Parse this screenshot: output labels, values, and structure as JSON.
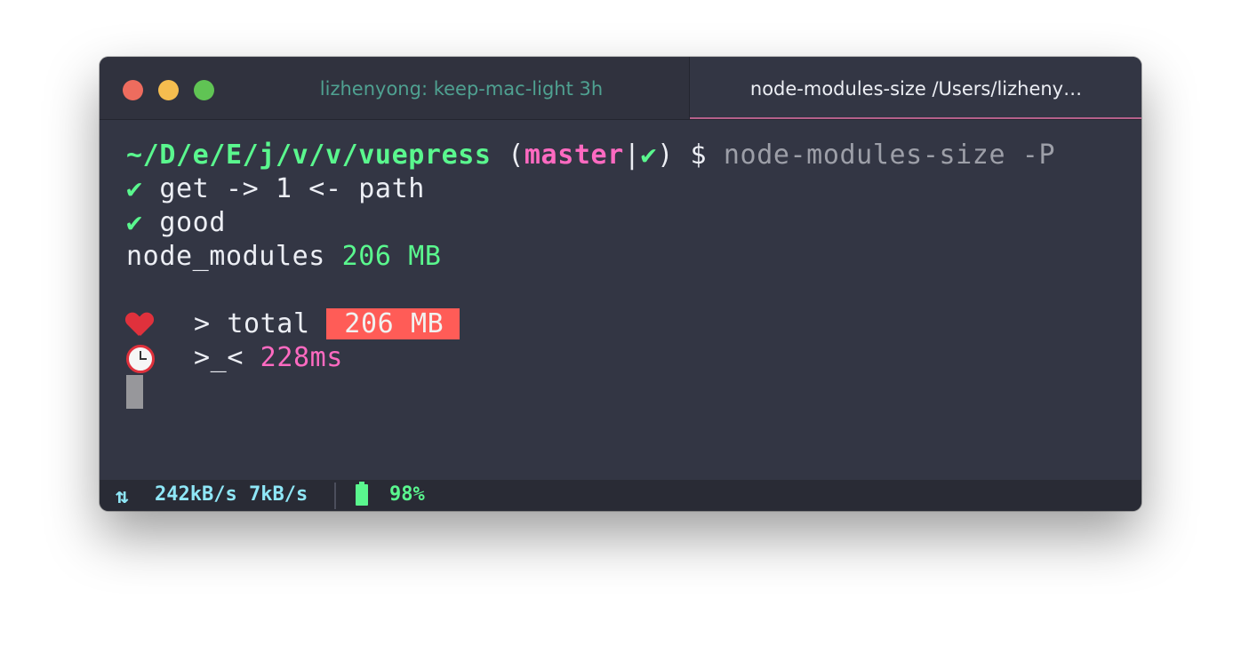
{
  "window": {
    "traffic_lights": {
      "close": "#ee6c5e",
      "minimize": "#f5bd4f",
      "zoom": "#60c454"
    },
    "tabs": [
      {
        "label": "lizhenyong: keep-mac-light 3h",
        "active": false
      },
      {
        "label": "node-modules-size /Users/lizheny…",
        "active": true
      }
    ]
  },
  "terminal": {
    "prompt": {
      "path": "~/D/e/E/j/v/v/vuepress",
      "open_paren": " (",
      "branch": "master",
      "pipe": "|",
      "status_check": "✔",
      "close": ") $ ",
      "command": "node-modules-size -P"
    },
    "lines": [
      {
        "check": "✔",
        "text": " get -> 1 <- path"
      },
      {
        "check": "✔",
        "text": " good"
      }
    ],
    "result": {
      "label": "node_modules ",
      "size": "206 MB"
    },
    "total": {
      "icon": "heart-emoji-icon",
      "prefix": "> total ",
      "value": "206 MB"
    },
    "timing": {
      "icon": "alarm-clock-emoji-icon",
      "prefix": ">_< ",
      "value": "228ms"
    }
  },
  "statusbar": {
    "net_icon": "⇅",
    "download": "242kB/s",
    "upload": "7kB/s",
    "battery_percent": "98%",
    "battery_level": 0.98
  },
  "colors": {
    "background": "#333644",
    "green": "#5af78e",
    "pink": "#ff6ac1",
    "red_badge": "#ff5c57",
    "cyan": "#8fe7f7"
  }
}
